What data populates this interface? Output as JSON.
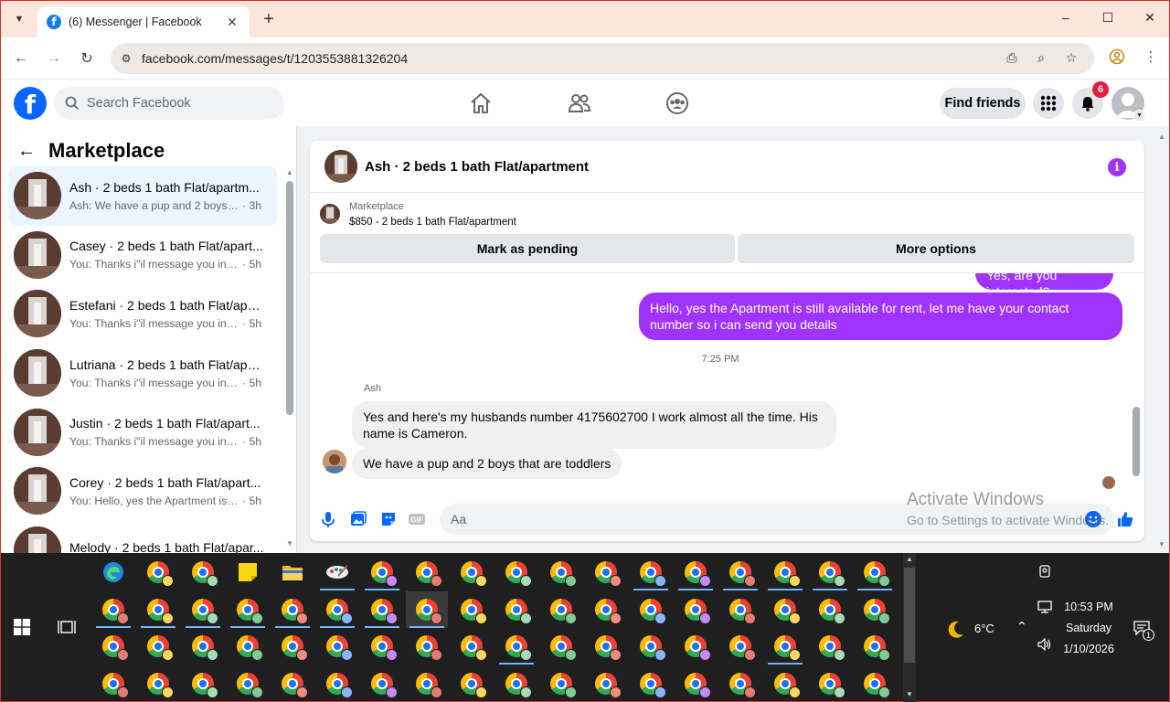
{
  "browser": {
    "tab_title": "(6) Messenger | Facebook",
    "url": "facebook.com/messages/t/1203553881326204",
    "new_tab_symbol": "+",
    "window_controls": [
      "–",
      "☐",
      "✕"
    ]
  },
  "fb": {
    "search_placeholder": "Search Facebook",
    "find_friends": "Find friends",
    "notification_count": "6",
    "brand_color": "#0866ff",
    "accent_color": "#a033ff"
  },
  "left_panel": {
    "title": "Marketplace",
    "conversations": [
      {
        "title": "Ash · 2 beds 1 bath Flat/apartm...",
        "snippet": "Ash: We have a pup and 2 boys tha...",
        "time": "· 3h",
        "active": true
      },
      {
        "title": "Casey · 2 beds 1 bath Flat/apart...",
        "snippet": "You: Thanks i\"il message you in a ...",
        "time": "· 5h"
      },
      {
        "title": "Estefani · 2 beds 1 bath Flat/apa...",
        "snippet": "You: Thanks i\"il message you in a ...",
        "time": "· 5h"
      },
      {
        "title": "Lutriana · 2 beds 1 bath Flat/apa...",
        "snippet": "You: Thanks i\"il message you in a ...",
        "time": "· 5h"
      },
      {
        "title": "Justin · 2 beds 1 bath Flat/apart...",
        "snippet": "You: Thanks i\"il message you in a ...",
        "time": "· 5h"
      },
      {
        "title": "Corey · 2 beds 1 bath Flat/apart...",
        "snippet": "You: Hello, yes the Apartment is stil...",
        "time": "· 5h"
      },
      {
        "title": "Melody · 2 beds 1 bath Flat/apar...",
        "snippet": "",
        "time": ""
      }
    ]
  },
  "chat": {
    "title": "Ash · 2 beds 1 bath Flat/apartment",
    "listing_label": "Marketplace",
    "listing_price": "$850 - 2 beds 1 bath Flat/apartment",
    "mark_pending": "Mark as pending",
    "more_options": "More options",
    "messages": {
      "out_partial": "Yes, are you interested?",
      "out_main": "Hello, yes the Apartment is still available for rent, let me have your contact number so i can send you details",
      "time": "7:25 PM",
      "sender": "Ash",
      "in_1": "Yes and here's my husbands number 4175602700 I work almost all the time. His name is Cameron.",
      "in_2": "We have a pup and 2 boys that are toddlers"
    },
    "composer_placeholder": "Aa"
  },
  "watermark": {
    "title": "Activate Windows",
    "subtitle": "Go to Settings to activate Windows."
  },
  "taskbar": {
    "weather": "6°C",
    "time": "10:53 PM",
    "day": "Saturday",
    "date": "1/10/2026",
    "notification_count": "1"
  }
}
